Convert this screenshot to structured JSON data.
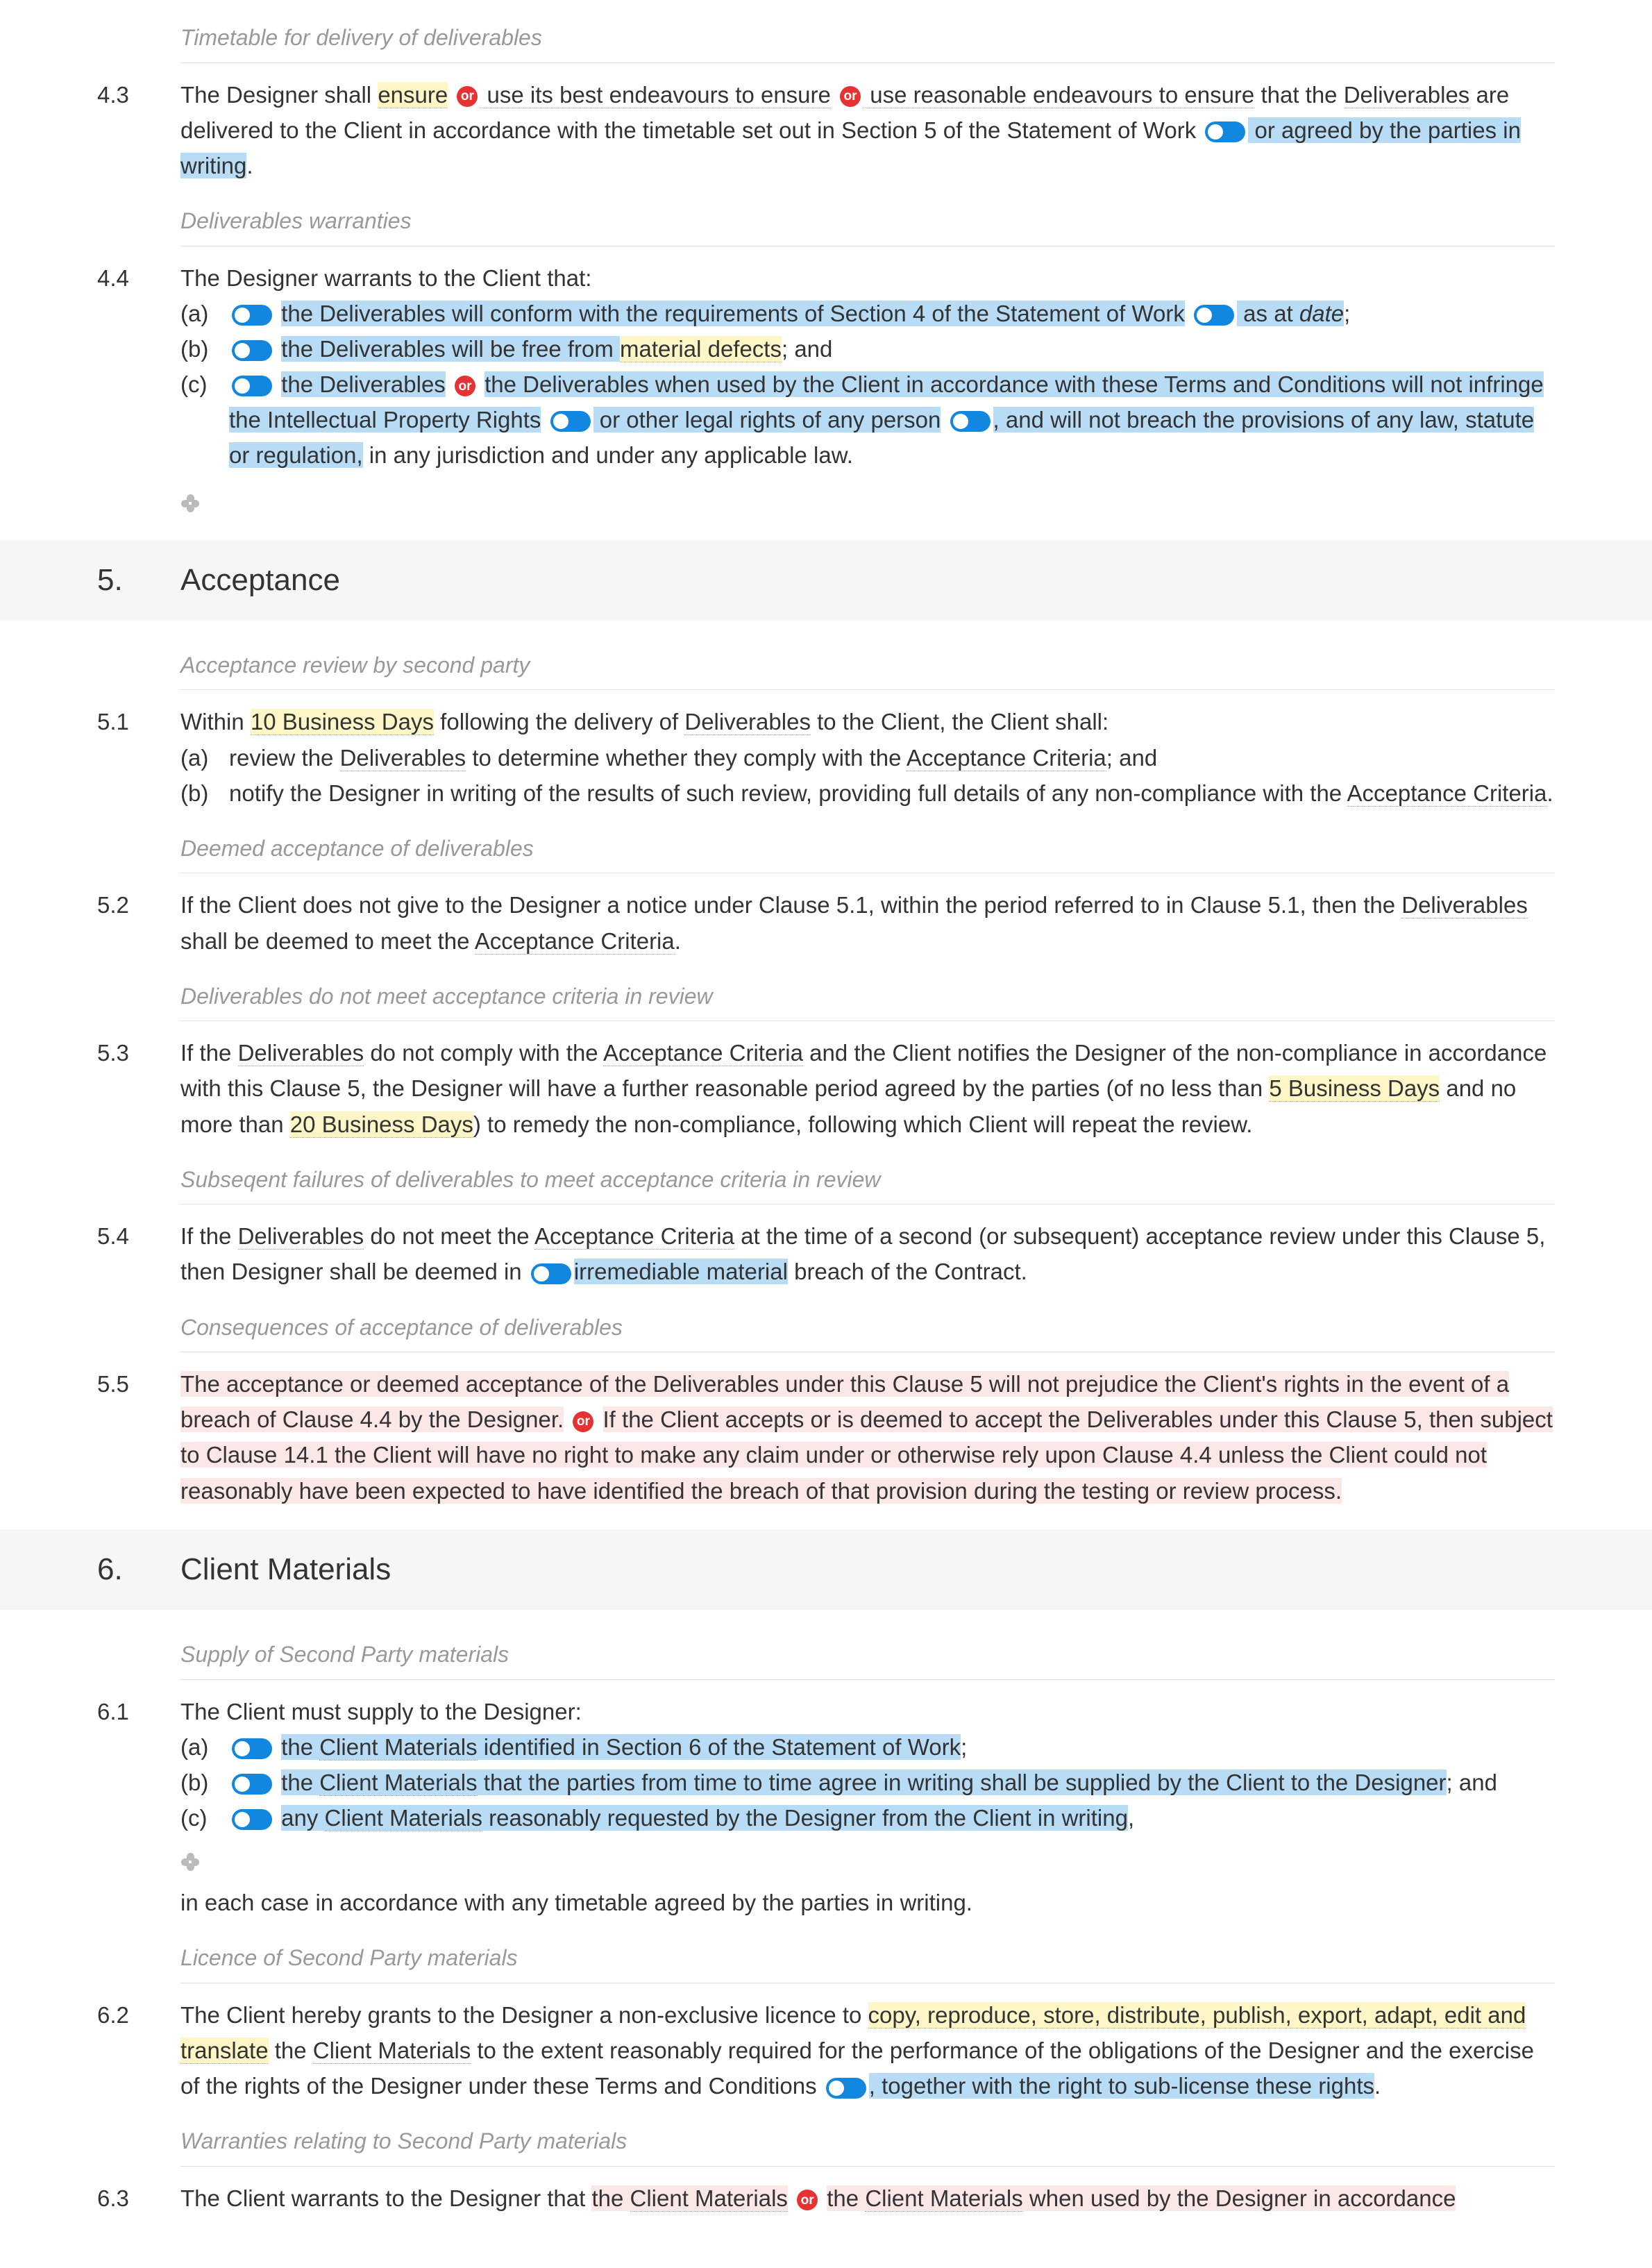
{
  "or_label": "or",
  "s4": {
    "h_timetable": "Timetable for delivery of deliverables",
    "c43": {
      "num": "4.3",
      "t1": "The Designer shall ",
      "y1": "ensure",
      "t2": " use its best endeavours to ensure",
      "t3": " use reasonable endeavours to ensure",
      "t4": " that the ",
      "d1": "Deliverables",
      "t5": " are delivered to the Client in accordance with the timetable set out in Section 5 of the Statement of Work",
      "b1": " or agreed by the parties in writing",
      "t6": "."
    },
    "h_warr": "Deliverables warranties",
    "c44": {
      "num": "4.4",
      "intro": "The Designer warrants to the Client that:",
      "a_m": "(a)",
      "a_b1": "the Deliverables will conform with the requirements of Section 4 of the Statement of Work",
      "a_b2": " as at ",
      "a_i": "date",
      "a_t": ";",
      "b_m": "(b)",
      "b_b1": "the Deliverables will be free from ",
      "b_y": "material defects",
      "b_t": "; and",
      "c_m": "(c)",
      "c_b1": "the Deliverables",
      "c_b2": "the Deliverables when used by the Client in accordance with these Terms and Conditions",
      "c_b3": " will not infringe the Intellectual Property Rights",
      "c_b4": " or other legal rights",
      "c_t1": " of any person",
      "c_b5": ", and will not breach the provisions of any law, statute or regulation,",
      "c_t2": " in any jurisdiction and under any applicable law."
    }
  },
  "s5": {
    "num": "5.",
    "title": "Acceptance",
    "h_rev": "Acceptance review by second party",
    "c51": {
      "num": "5.1",
      "t1": "Within ",
      "y1": "10 Business Days",
      "t2": " following the delivery of ",
      "d1": "Deliverables",
      "t3": " to the Client, the Client shall:",
      "a_m": "(a)",
      "a_t1": "review the ",
      "a_d1": "Deliverables",
      "a_t2": " to determine whether they comply with the ",
      "a_d2": "Acceptance Criteria",
      "a_t3": "; and",
      "b_m": "(b)",
      "b_t1": "notify the Designer in writing of the results of such review, providing full details of any non-compliance with the ",
      "b_d1": "Acceptance Criteria",
      "b_t2": "."
    },
    "h_deemed": "Deemed acceptance of deliverables",
    "c52": {
      "num": "5.2",
      "t1": "If the Client does not give to the Designer a notice under Clause 5.1, within the period referred to in Clause 5.1, then the ",
      "d1": "Deliverables",
      "t2": " shall be deemed to meet the ",
      "d2": "Acceptance Criteria",
      "t3": "."
    },
    "h_notmeet": "Deliverables do not meet acceptance criteria in review",
    "c53": {
      "num": "5.3",
      "t1": "If the ",
      "d1": "Deliverables",
      "t2": " do not comply with the ",
      "d2": "Acceptance Criteria",
      "t3": " and the Client notifies the Designer of the non-compliance in accordance with this Clause 5, the Designer will have a further reasonable period agreed by the parties (of no less than ",
      "y1": "5 Business Days",
      "t4": " and no more than ",
      "y2": "20 Business Days",
      "t5": ") to remedy the non-compliance, following which Client will repeat the review."
    },
    "h_subseq": "Subseqent failures of deliverables to meet acceptance criteria in review",
    "c54": {
      "num": "5.4",
      "t1": "If the ",
      "d1": "Deliverables",
      "t2": " do not meet the ",
      "d2": "Acceptance Criteria",
      "t3": " at the time of a second (or subsequent) acceptance review under this Clause 5, then Designer shall be deemed in ",
      "b1": "irremediable material",
      "t4": " breach of the Contract."
    },
    "h_conseq": "Consequences of acceptance of deliverables",
    "c55": {
      "num": "5.5",
      "p1": "The acceptance or deemed acceptance of the Deliverables under this Clause 5 will not prejudice the Client's rights in the event of a breach of Clause 4.4 by the Designer.",
      "p2": "If the Client accepts or is deemed to accept the Deliverables under this Clause 5, then subject to Clause 14.1 the Client will have no right to make any claim under or otherwise rely upon Clause 4.4 unless the Client could not reasonably have been expected to have identified the breach of that provision during the testing or review process."
    }
  },
  "s6": {
    "num": "6.",
    "title": "Client Materials",
    "h_supply": "Supply of Second Party materials",
    "c61": {
      "num": "6.1",
      "intro": "The Client must supply to the Designer:",
      "a_m": "(a)",
      "a_t1": "the ",
      "a_d1": "Client Materials",
      "a_t2": " identified in Section 6 of the Statement of Work",
      "a_t3": ";",
      "b_m": "(b)",
      "b_t1": "the ",
      "b_d1": "Client Materials",
      "b_t2": " that the parties from time to time agree in writing shall be supplied by the Client to the Designer",
      "b_t3": "; and",
      "c_m": "(c)",
      "c_t1": "any ",
      "c_d1": "Client Materials",
      "c_t2": " reasonably requested by the Designer from the Client in writing",
      "c_t3": ",",
      "tail": "in each case in accordance with any timetable agreed by the parties in writing."
    },
    "h_lic": "Licence of Second Party materials",
    "c62": {
      "num": "6.2",
      "t1": "The Client hereby grants to the Designer a non-exclusive licence to ",
      "y1": "copy, reproduce, store, distribute, publish, export, adapt, edit and translate",
      "t2": " the ",
      "d1": "Client Materials",
      "t3": " to the extent reasonably required for the performance of the obligations of the Designer and the exercise of the rights of the Designer under these Terms and Conditions",
      "b1": ", together with the right to sub-license these rights",
      "t4": "."
    },
    "h_warr": "Warranties relating to Second Party materials",
    "c63": {
      "num": "6.3",
      "t1": "The Client warrants to the Designer that ",
      "p1a": "the ",
      "p1b": "Client Materials",
      "p2a": "the ",
      "p2b": "Client Materials",
      "p2c": " when used by the Designer in accordance"
    }
  }
}
